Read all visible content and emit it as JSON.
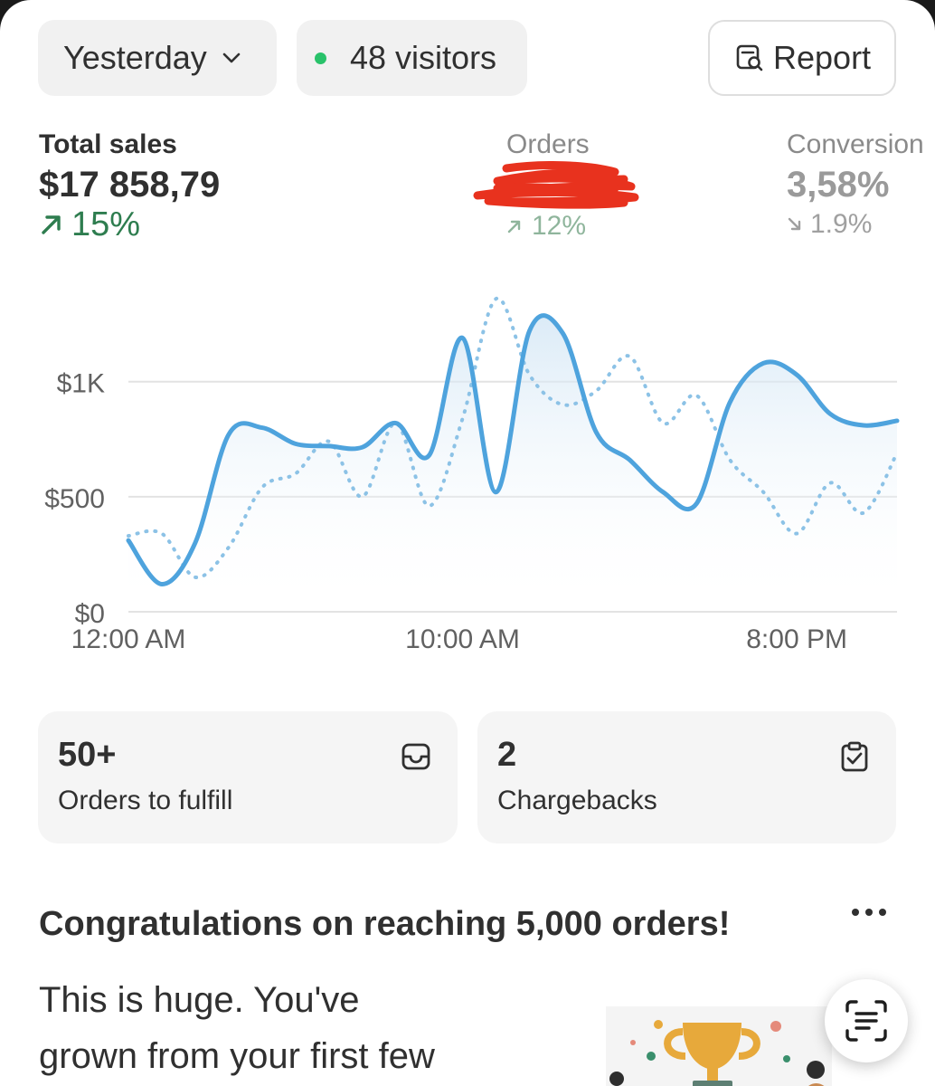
{
  "header": {
    "period_label": "Yesterday",
    "visitors_label": "48 visitors",
    "report_label": "Report"
  },
  "metrics": {
    "total_sales": {
      "label": "Total sales",
      "value": "$17 858,79",
      "delta": "15%",
      "trend": "up"
    },
    "orders": {
      "label": "Orders",
      "value": "",
      "delta": "12%",
      "trend": "up",
      "redacted": true
    },
    "conversion": {
      "label": "Conversion",
      "value": "3,58%",
      "delta": "1.9%",
      "trend": "down"
    }
  },
  "chart_data": {
    "type": "line",
    "x": [
      "12:00 AM",
      "1:00 AM",
      "2:00 AM",
      "3:00 AM",
      "4:00 AM",
      "5:00 AM",
      "6:00 AM",
      "7:00 AM",
      "8:00 AM",
      "9:00 AM",
      "10:00 AM",
      "11:00 AM",
      "12:00 PM",
      "1:00 PM",
      "2:00 PM",
      "3:00 PM",
      "4:00 PM",
      "5:00 PM",
      "6:00 PM",
      "7:00 PM",
      "8:00 PM",
      "9:00 PM",
      "10:00 PM",
      "11:00 PM"
    ],
    "xticks": [
      "12:00 AM",
      "10:00 AM",
      "8:00 PM"
    ],
    "yticks": [
      "$0",
      "$500",
      "$1K"
    ],
    "ylim": [
      0,
      1400
    ],
    "grid": true,
    "series": [
      {
        "style": "solid",
        "color": "#4ea3dd",
        "values": [
          310,
          120,
          300,
          770,
          800,
          730,
          720,
          715,
          820,
          680,
          1190,
          520,
          1220,
          1210,
          780,
          660,
          520,
          470,
          910,
          1080,
          1030,
          860,
          810,
          830
        ]
      },
      {
        "style": "dotted",
        "color": "#8cc2e6",
        "values": [
          330,
          340,
          150,
          280,
          540,
          600,
          740,
          500,
          820,
          460,
          840,
          1360,
          1030,
          900,
          960,
          1110,
          820,
          940,
          660,
          520,
          340,
          560,
          430,
          690
        ]
      }
    ]
  },
  "cards": [
    {
      "value": "50+",
      "label": "Orders to fulfill",
      "icon": "inbox-icon"
    },
    {
      "value": "2",
      "label": "Chargebacks",
      "icon": "clipboard-check-icon"
    }
  ],
  "announcement": {
    "title": "Congratulations on reaching 5,000 orders!",
    "body_line1": "This is huge. You've",
    "body_line2": "grown from your first few"
  }
}
